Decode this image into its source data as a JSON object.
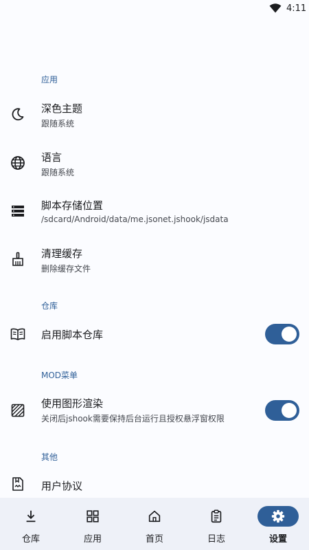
{
  "status_bar": {
    "time": "4:11"
  },
  "sections": {
    "app": {
      "header": "应用",
      "items": [
        {
          "title": "深色主题",
          "subtitle": "跟随系统",
          "icon": "moon-icon"
        },
        {
          "title": "语言",
          "subtitle": "跟随系统",
          "icon": "globe-icon"
        },
        {
          "title": "脚本存储位置",
          "subtitle": "/sdcard/Android/data/me.jsonet.jshook/jsdata",
          "icon": "storage-icon"
        },
        {
          "title": "清理缓存",
          "subtitle": "删除缓存文件",
          "icon": "broom-icon"
        }
      ]
    },
    "repo": {
      "header": "仓库",
      "items": [
        {
          "title": "启用脚本仓库",
          "icon": "book-icon",
          "toggle_on": true
        }
      ]
    },
    "mod": {
      "header": "MOD菜单",
      "items": [
        {
          "title": "使用图形渲染",
          "subtitle": "关闭后jshook需要保持后台运行且授权悬浮窗权限",
          "icon": "texture-icon",
          "toggle_on": true
        }
      ]
    },
    "other": {
      "header": "其他",
      "items": [
        {
          "title": "用户协议",
          "icon": "agreement-icon"
        }
      ]
    }
  },
  "bottom_nav": {
    "items": [
      {
        "label": "仓库",
        "icon": "download-icon"
      },
      {
        "label": "应用",
        "icon": "apps-grid-icon"
      },
      {
        "label": "首页",
        "icon": "home-icon"
      },
      {
        "label": "日志",
        "icon": "clipboard-icon"
      },
      {
        "label": "设置",
        "icon": "gear-icon",
        "active": true
      }
    ]
  },
  "colors": {
    "accent": "#2f5f98",
    "background": "#fbfcff",
    "nav_background": "#eef1f8"
  }
}
